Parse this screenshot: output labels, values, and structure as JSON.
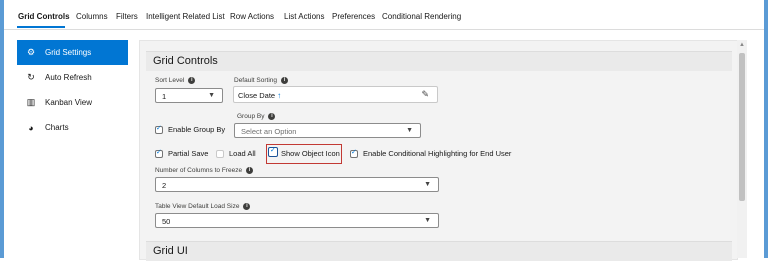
{
  "tabs": [
    {
      "label": "Grid Controls",
      "active": true
    },
    {
      "label": "Columns",
      "active": false
    },
    {
      "label": "Filters",
      "active": false
    },
    {
      "label": "Intelligent Related List",
      "active": false
    },
    {
      "label": "Row Actions",
      "active": false
    },
    {
      "label": "List Actions",
      "active": false
    },
    {
      "label": "Preferences",
      "active": false
    },
    {
      "label": "Conditional Rendering",
      "active": false
    }
  ],
  "sidebar": {
    "items": [
      {
        "label": "Grid Settings",
        "icon": "gear-icon",
        "active": true
      },
      {
        "label": "Auto Refresh",
        "icon": "refresh-icon",
        "active": false
      },
      {
        "label": "Kanban View",
        "icon": "kanban-icon",
        "active": false
      },
      {
        "label": "Charts",
        "icon": "pie-chart-icon",
        "active": false
      }
    ]
  },
  "grid_controls": {
    "title": "Grid Controls",
    "sort_level": {
      "label": "Sort Level",
      "value": "1"
    },
    "default_sorting": {
      "label": "Default Sorting",
      "value": "Close Date"
    },
    "group_by": {
      "label": "Group By",
      "placeholder": "Select an Option"
    },
    "enable_group_by": {
      "label": "Enable Group By",
      "checked": true
    },
    "partial_save": {
      "label": "Partial Save",
      "checked": true
    },
    "load_all": {
      "label": "Load All",
      "checked": false
    },
    "show_object_icon": {
      "label": "Show Object Icon",
      "checked": true
    },
    "conditional_highlighting": {
      "label": "Enable Conditional Highlighting for End User",
      "checked": true
    },
    "columns_to_freeze": {
      "label": "Number of Columns to Freeze",
      "value": "2"
    },
    "table_view_load_size": {
      "label": "Table View Default Load Size",
      "value": "50"
    }
  },
  "grid_ui": {
    "title": "Grid UI"
  },
  "colors": {
    "accent": "#0176d3",
    "highlight_border": "#c23934"
  }
}
